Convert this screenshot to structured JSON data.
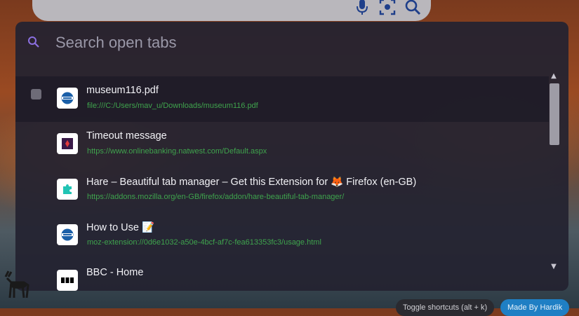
{
  "browser_search": {
    "icons": [
      "microphone-icon",
      "lens-icon",
      "search-icon"
    ]
  },
  "tab_search": {
    "placeholder": "Search open tabs",
    "value": ""
  },
  "tabs": [
    {
      "title": "museum116.pdf",
      "url": "file:///C:/Users/mav_u/Downloads/museum116.pdf",
      "favicon": "globe-icon",
      "selected": true
    },
    {
      "title": "Timeout message",
      "url": "https://www.onlinebanking.natwest.com/Default.aspx",
      "favicon": "natwest-icon"
    },
    {
      "title": "Hare – Beautiful tab manager – Get this Extension for 🦊 Firefox (en-GB)",
      "url": "https://addons.mozilla.org/en-GB/firefox/addon/hare-beautiful-tab-manager/",
      "favicon": "puzzle-icon"
    },
    {
      "title": "How to Use 📝",
      "url": "moz-extension://0d6e1032-a50e-4bcf-af7c-fea613353fc3/usage.html",
      "favicon": "globe-icon"
    },
    {
      "title": "BBC - Home",
      "url": "",
      "favicon": "bbc-icon"
    }
  ],
  "footer": {
    "toggle_label": "Toggle shortcuts (alt + k)",
    "made_by_label": "Made By Hardik"
  },
  "colors": {
    "panel": "#242230",
    "url_green": "#3fa34d",
    "accent_purple": "#8b6fe0",
    "made_by_blue": "#1f7fc4"
  }
}
